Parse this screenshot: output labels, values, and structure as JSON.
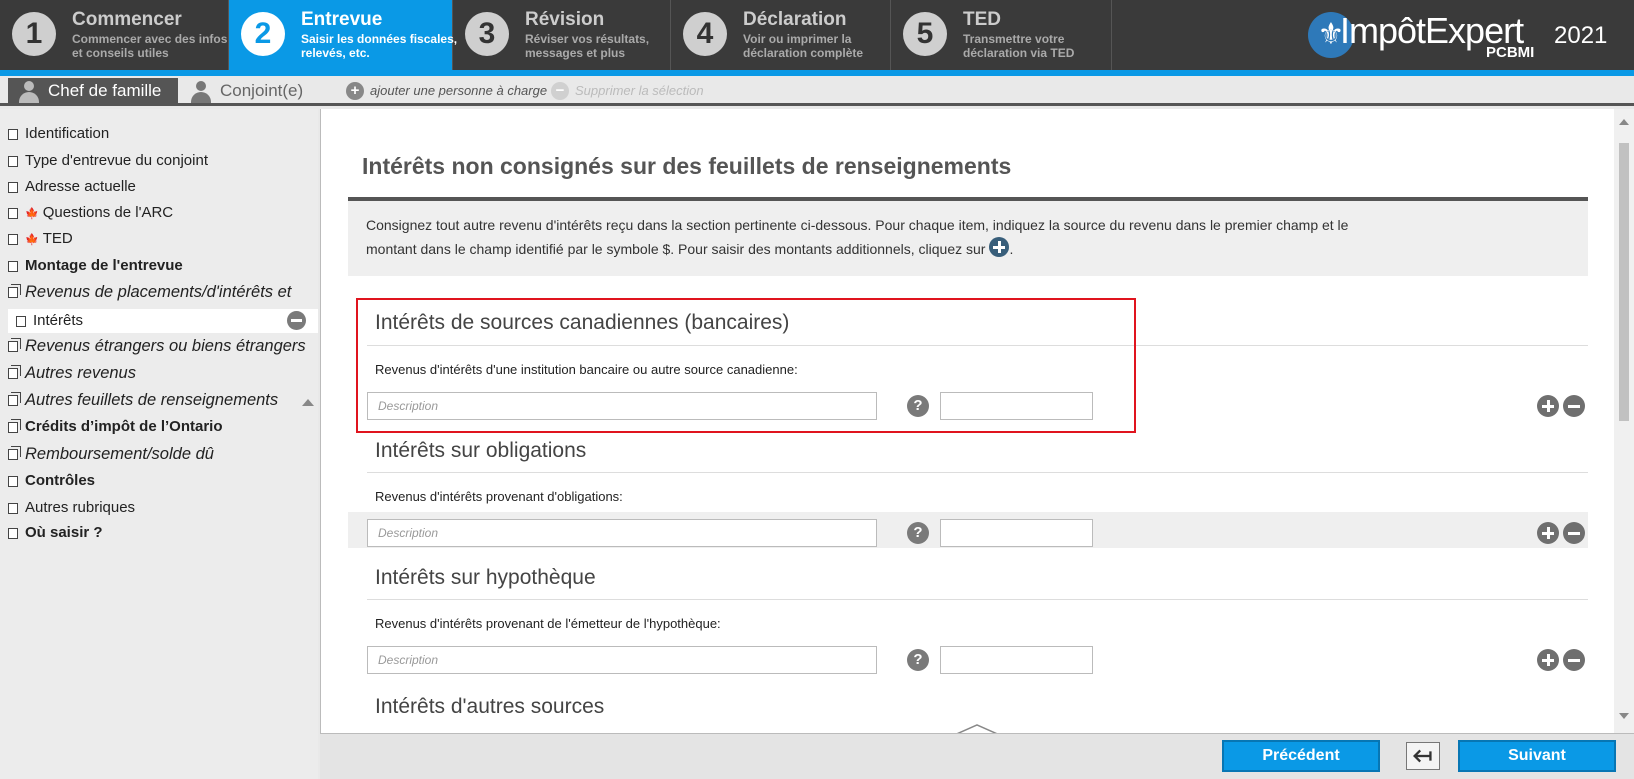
{
  "steps": [
    {
      "num": "1",
      "title": "Commencer",
      "desc1": "Commencer avec des infos",
      "desc2": "et conseils utiles"
    },
    {
      "num": "2",
      "title": "Entrevue",
      "desc1": "Saisir les données fiscales,",
      "desc2": "relevés, etc."
    },
    {
      "num": "3",
      "title": "Révision",
      "desc1": "Réviser vos résultats,",
      "desc2": "messages et plus"
    },
    {
      "num": "4",
      "title": "Déclaration",
      "desc1": "Voir ou imprimer la",
      "desc2": "déclaration complète"
    },
    {
      "num": "5",
      "title": "TED",
      "desc1": "Transmettre votre",
      "desc2": "déclaration via TED"
    }
  ],
  "logo": {
    "brand": "ImpôtExpert",
    "sub": "PCBMI",
    "year": "2021"
  },
  "persons": {
    "head": "Chef de famille",
    "spouse": "Conjoint(e)",
    "add_dependent": "ajouter une personne à charge",
    "delete_selection": "Supprimer la sélection"
  },
  "sidebar": {
    "items": [
      "Identification",
      "Type d'entrevue du conjoint",
      "Adresse actuelle",
      "Questions de l'ARC",
      "TED",
      "Montage de l'entrevue",
      "Revenus de placements/d'intérêts et",
      "Intérêts",
      "Revenus étrangers ou biens étrangers",
      "Autres revenus",
      "Autres feuillets de renseignements",
      "Crédits d’impôt de l’Ontario",
      "Remboursement/solde dû",
      "Contrôles",
      "Autres rubriques",
      "Où saisir ?"
    ]
  },
  "main": {
    "title": "Intérêts non consignés sur des feuillets de renseignements",
    "intro_line1": "Consignez tout autre revenu d'intérêts reçu dans la section pertinente ci-dessous. Pour chaque item, indiquez la source du revenu dans le premier champ et le",
    "intro_line2": "montant dans le champ identifié par le symbole $. Pour saisir des montants additionnels, cliquez sur",
    "sections": [
      {
        "title": "Intérêts de sources canadiennes (bancaires)",
        "label": "Revenus d'intérêts d'une institution bancaire ou autre source canadienne:",
        "placeholder": "Description",
        "amount": ""
      },
      {
        "title": "Intérêts sur obligations",
        "label": "Revenus d'intérêts provenant d'obligations:",
        "placeholder": "Description",
        "amount": ""
      },
      {
        "title": "Intérêts sur hypothèque",
        "label": "Revenus d'intérêts provenant de l'émetteur de l'hypothèque:",
        "placeholder": "Description",
        "amount": ""
      },
      {
        "title": "Intérêts d'autres sources"
      }
    ],
    "help_glyph": "?"
  },
  "bottom": {
    "prev": "Précédent",
    "next": "Suivant"
  },
  "colors": {
    "accent": "#0a99e6",
    "topbar": "#3a3a3a",
    "highlight": "#e0141e"
  }
}
